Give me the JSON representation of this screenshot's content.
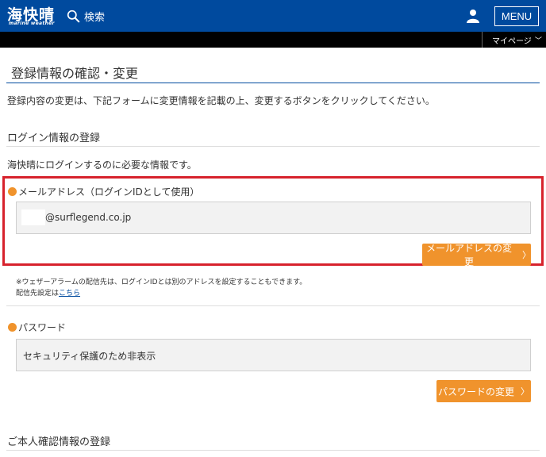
{
  "header": {
    "logo_main": "海快晴",
    "logo_sub": "marine weather",
    "search_label": "検索",
    "menu_label": "MENU"
  },
  "subbar": {
    "mypage_label": "マイページ"
  },
  "page": {
    "title": "登録情報の確認・変更",
    "intro": "登録内容の変更は、下記フォームに変更情報を記載の上、変更するボタンをクリックしてください。"
  },
  "login_section": {
    "heading": "ログイン情報の登録",
    "description": "海快晴にログインするのに必要な情報です。",
    "email": {
      "label": "メールアドレス（ログインIDとして使用）",
      "value": "@surflegend.co.jp",
      "button_label": "メールアドレスの変更"
    },
    "note_line1": "※ウェザーアラームの配信先は、ログインIDとは別のアドレスを設定することもできます。",
    "note_line2_prefix": "配信先設定は",
    "note_link": "こちら",
    "password": {
      "label": "パスワード",
      "value": "セキュリティ保護のため非表示",
      "button_label": "パスワードの変更"
    }
  },
  "identity_section": {
    "heading": "ご本人確認情報の登録"
  },
  "colors": {
    "header_bg": "#004a9e",
    "accent_orange": "#f0932c",
    "highlight_red": "#d7222c"
  }
}
